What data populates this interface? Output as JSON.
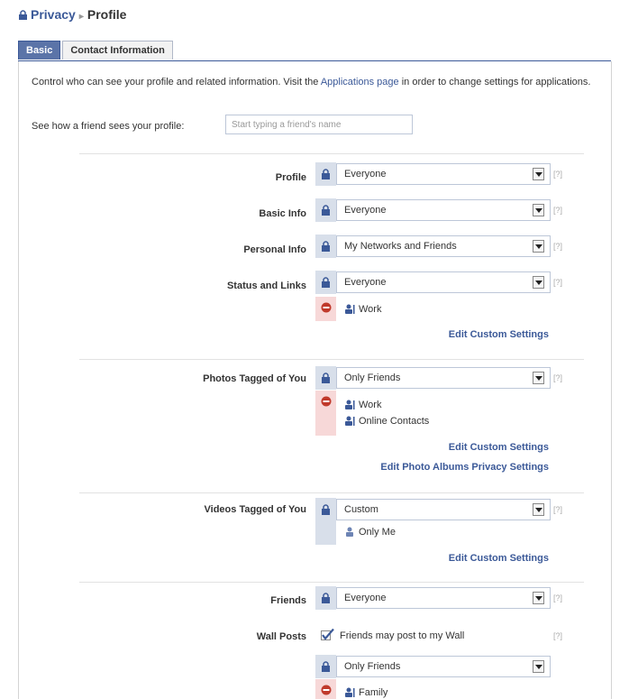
{
  "breadcrumb": {
    "parent": "Privacy",
    "separator": "▸",
    "current": "Profile"
  },
  "tabs": [
    {
      "label": "Basic",
      "active": true
    },
    {
      "label": "Contact Information",
      "active": false
    }
  ],
  "intro": {
    "text_before": "Control who can see your profile and related information. Visit the ",
    "link": "Applications page",
    "text_after": " in order to change settings for applications."
  },
  "preview": {
    "label": "See how a friend sees your profile:",
    "placeholder": "Start typing a friend's name"
  },
  "help_text": "[?]",
  "rows": {
    "profile": {
      "label": "Profile",
      "value": "Everyone"
    },
    "basic_info": {
      "label": "Basic Info",
      "value": "Everyone"
    },
    "personal_info": {
      "label": "Personal Info",
      "value": "My Networks and Friends"
    },
    "status_links": {
      "label": "Status and Links",
      "value": "Everyone",
      "excluded": [
        "Work"
      ],
      "edit_label": "Edit Custom Settings"
    },
    "photos_tagged": {
      "label": "Photos Tagged of You",
      "value": "Only Friends",
      "excluded": [
        "Work",
        "Online Contacts"
      ],
      "edit_label": "Edit Custom Settings",
      "edit_albums_label": "Edit Photo Albums Privacy Settings"
    },
    "videos_tagged": {
      "label": "Videos Tagged of You",
      "value": "Custom",
      "allowed": [
        "Only Me"
      ],
      "edit_label": "Edit Custom Settings"
    },
    "friends": {
      "label": "Friends",
      "value": "Everyone"
    },
    "wall_posts": {
      "label": "Wall Posts",
      "checkbox_label": "Friends may post to my Wall",
      "checked": true,
      "value": "Only Friends",
      "excluded": [
        "Family"
      ]
    }
  },
  "colors": {
    "accent": "#3b5998",
    "exclude": "#f7d8d8",
    "lock_bg": "#d8dfea"
  }
}
